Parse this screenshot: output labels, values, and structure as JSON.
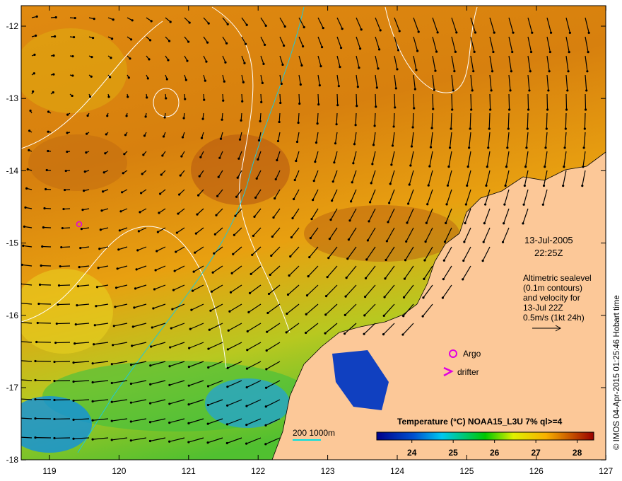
{
  "map": {
    "x_ticks": [
      "119",
      "120",
      "121",
      "122",
      "123",
      "124",
      "125",
      "126",
      "127"
    ],
    "y_ticks": [
      "-12",
      "-13",
      "-14",
      "-15",
      "-16",
      "-17",
      "-18"
    ],
    "date": "13-Jul-2005",
    "time": "22:25Z",
    "legend_lines": [
      "Altimetric sealevel",
      "(0.1m contours)",
      "and velocity for",
      "13-Jul 22Z",
      "0.5m/s (1kt 24h)"
    ],
    "argo_label": "Argo",
    "drifter_label": "drifter",
    "scale_label": "200  1000m",
    "copyright": "© IMOS 04-Apr-2015 01:25:46 Hobart time",
    "colors": {
      "land": "#fcc898",
      "argo": "#e000e0",
      "bathy": "#00e0e0"
    }
  },
  "colorbar": {
    "title": "Temperature (°C) NOAA15_L3U 7% ql>=4",
    "ticks": [
      "24",
      "25",
      "26",
      "27",
      "28"
    ],
    "range": [
      23.15,
      28.4
    ]
  }
}
